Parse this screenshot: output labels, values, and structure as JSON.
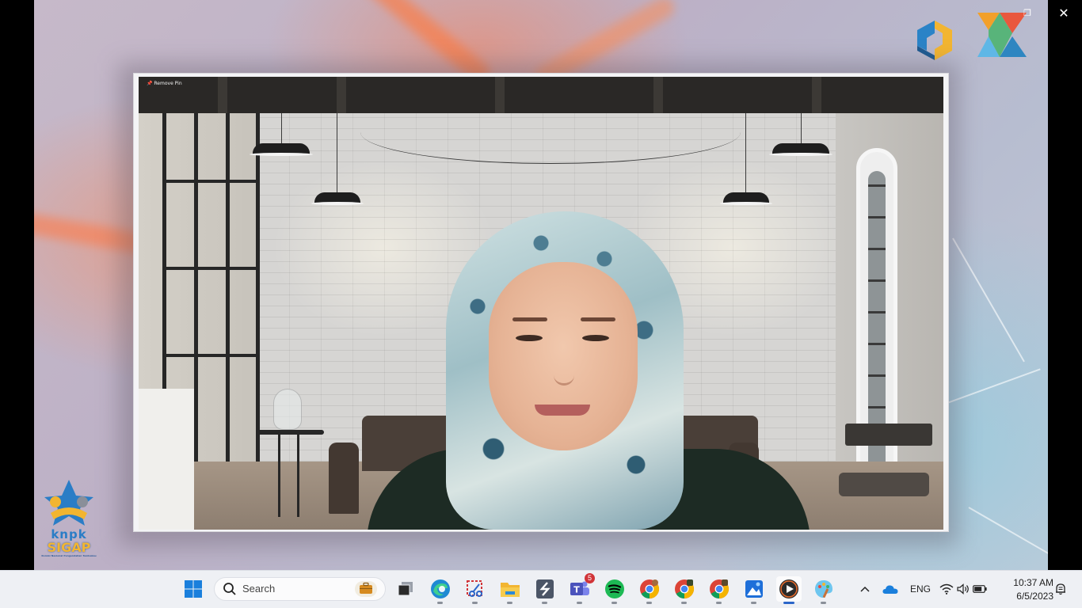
{
  "window": {
    "restore_glyph": "❐",
    "close_glyph": "✕"
  },
  "video": {
    "pin_label": "Remove Pin"
  },
  "logos": {
    "bottom_left_line1": "knpk",
    "bottom_left_line2": "SIGAP",
    "bottom_left_tagline": "Komisi Nasional Pengendalian Tembakau"
  },
  "taskbar": {
    "search_placeholder": "Search",
    "apps": [
      {
        "icon": "windows-start-icon"
      },
      {
        "icon": "task-view-icon"
      },
      {
        "icon": "edge-icon"
      },
      {
        "icon": "snipping-tool-icon"
      },
      {
        "icon": "file-explorer-icon"
      },
      {
        "icon": "app-s-icon"
      },
      {
        "icon": "teams-icon",
        "badge": "5"
      },
      {
        "icon": "spotify-icon"
      },
      {
        "icon": "chrome-icon"
      },
      {
        "icon": "chrome-profile-icon"
      },
      {
        "icon": "chrome-profile-2-icon"
      },
      {
        "icon": "photos-icon"
      },
      {
        "icon": "media-player-icon",
        "active": true
      },
      {
        "icon": "paint-icon"
      }
    ],
    "tray": {
      "language": "ENG",
      "time": "10:37 AM",
      "date": "6/5/2023"
    }
  },
  "colors": {
    "taskbar_bg": "#eef0f4",
    "accent": "#2b66c9",
    "badge": "#d13438"
  }
}
